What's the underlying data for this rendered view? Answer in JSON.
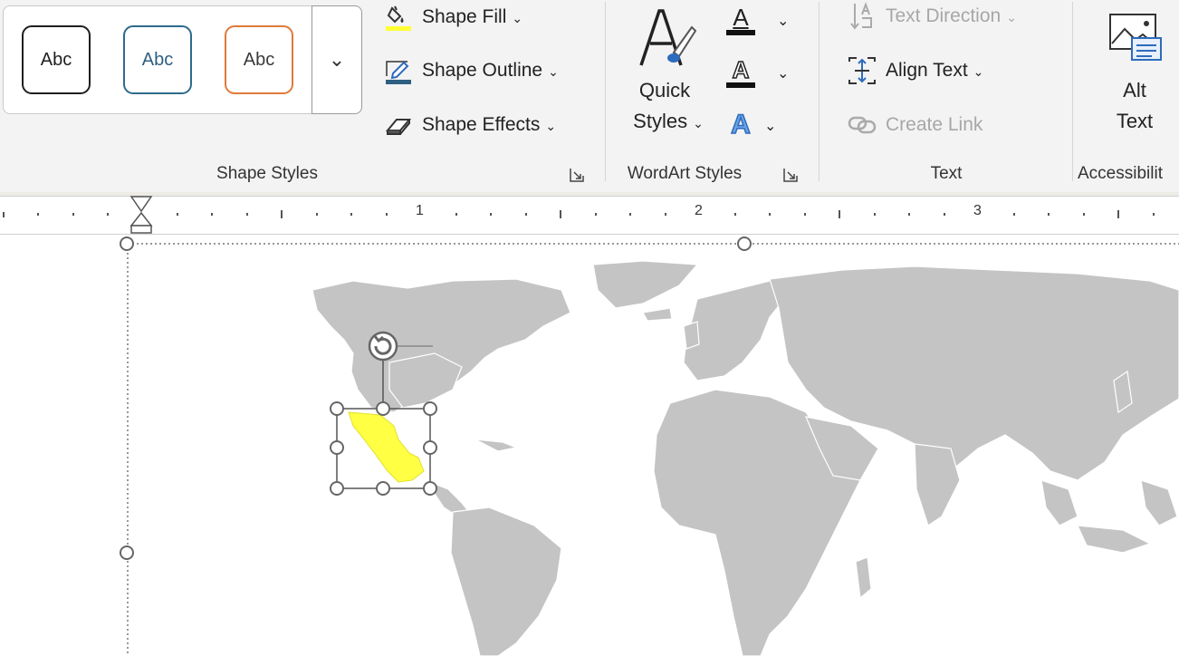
{
  "shape_styles": {
    "gallery": [
      {
        "label": "Abc",
        "border_color": "#1f1f1f",
        "text_color": "#1f1f1f"
      },
      {
        "label": "Abc",
        "border_color": "#2e6b8c",
        "text_color": "#2e5f80"
      },
      {
        "label": "Abc",
        "border_color": "#e07a3a",
        "text_color": "#3a3a3a"
      }
    ],
    "more_glyph": "⌄",
    "shape_fill": "Shape Fill",
    "shape_outline": "Shape Outline",
    "shape_effects": "Shape Effects",
    "group_label": "Shape Styles"
  },
  "wordart_styles": {
    "quick_styles_line1": "Quick",
    "quick_styles_line2": "Styles",
    "text_fill_glyph": "A",
    "text_outline_glyph": "A",
    "text_effects_glyph": "A",
    "group_label": "WordArt Styles"
  },
  "text_group": {
    "text_direction": "Text Direction",
    "align_text": "Align Text",
    "create_link": "Create Link",
    "group_label": "Text"
  },
  "accessibility": {
    "alt_text_line1": "Alt",
    "alt_text_line2": "Text",
    "group_label": "Accessibilit"
  },
  "ruler": {
    "numbers": [
      "1",
      "2",
      "3"
    ]
  },
  "colors": {
    "fill_underline": "#ffff33",
    "outline_underline": "#2e5f80",
    "highlight_country": "#ffff44",
    "map_land": "#c4c4c4"
  },
  "icons": [
    "paint-bucket-icon",
    "pencil-outline-icon",
    "eraser-effects-icon",
    "quick-styles-icon",
    "text-fill-icon",
    "text-outline-icon",
    "text-effects-icon",
    "text-direction-icon",
    "align-text-icon",
    "create-link-icon",
    "alt-text-icon",
    "dialog-launcher-icon",
    "rotate-handle-icon"
  ]
}
